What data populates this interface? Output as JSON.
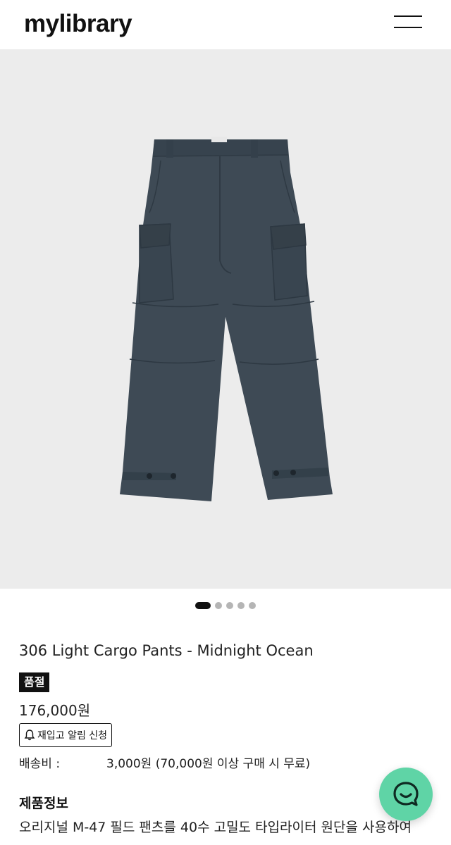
{
  "header": {
    "logo_text": "mylibrary",
    "menu_icon": "hamburger-menu-icon"
  },
  "gallery": {
    "image_description_icon": "cargo-pants-product-image",
    "slide_count": 5,
    "active_slide": 1
  },
  "product": {
    "title": "306 Light Cargo Pants - Midnight Ocean",
    "status_badge": "품절",
    "price": "176,000원",
    "restock_button": "재입고 알림 신청",
    "shipping_label": "배송비 :",
    "shipping_value": "3,000원 (70,000원 이상 구매 시 무료)"
  },
  "info": {
    "heading": "제품정보",
    "description": "오리지널 M-47 필드 팬츠를 40수 고밀도 타입라이터 원단을 사용하여"
  },
  "colors": {
    "chat_button": "#5fd4a6",
    "badge": "#111111",
    "gallery_bg": "#ececec",
    "pants": "#3e4a55"
  }
}
